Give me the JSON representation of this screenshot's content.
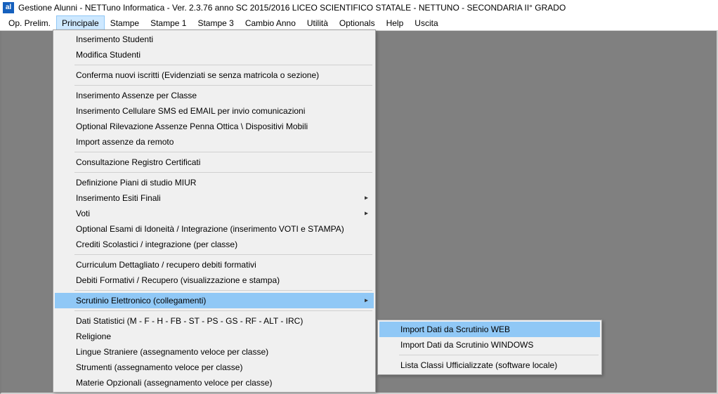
{
  "window": {
    "icon_text": "al",
    "title": "Gestione Alunni - NETTuno Informatica - Ver. 2.3.76 anno SC 2015/2016 LICEO SCIENTIFICO STATALE - NETTUNO - SECONDARIA II° GRADO"
  },
  "menubar": {
    "items": [
      "Op. Prelim.",
      "Principale",
      "Stampe",
      "Stampe 1",
      "Stampe 3",
      "Cambio Anno",
      "Utilità",
      "Optionals",
      "Help",
      "Uscita"
    ],
    "open_index": 1
  },
  "dropdown_principale": {
    "groups": [
      [
        "Inserimento Studenti",
        "Modifica Studenti"
      ],
      [
        "Conferma nuovi iscritti (Evidenziati se senza matricola o sezione)"
      ],
      [
        "Inserimento Assenze per Classe",
        "Inserimento Cellulare SMS ed EMAIL per invio comunicazioni",
        "Optional Rilevazione Assenze Penna Ottica \\ Dispositivi Mobili",
        "Import assenze da remoto"
      ],
      [
        "Consultazione Registro Certificati"
      ],
      [
        "Definizione Piani di studio MIUR",
        {
          "label": "Inserimento Esiti Finali",
          "submenu": true
        },
        {
          "label": "Voti",
          "submenu": true
        },
        "Optional Esami di Idoneità / Integrazione (inserimento VOTI e STAMPA)",
        "Crediti Scolastici / integrazione (per classe)"
      ],
      [
        "Curriculum Dettagliato / recupero debiti formativi",
        "Debiti Formativi / Recupero (visualizzazione e stampa)"
      ],
      [
        {
          "label": "Scrutinio Elettronico (collegamenti)",
          "submenu": true,
          "highlight": true
        }
      ],
      [
        "Dati Statistici  (M - F - H - FB - ST - PS - GS - RF - ALT - IRC)",
        "Religione",
        "Lingue Straniere (assegnamento veloce per classe)",
        "Strumenti (assegnamento veloce per classe)",
        "Materie Opzionali (assegnamento veloce per classe)"
      ]
    ]
  },
  "dropdown_scrutinio": {
    "groups": [
      [
        {
          "label": "Import Dati da Scrutinio WEB",
          "highlight": true
        },
        "Import Dati da Scrutinio WINDOWS"
      ],
      [
        "Lista Classi Ufficializzate (software locale)"
      ]
    ]
  }
}
